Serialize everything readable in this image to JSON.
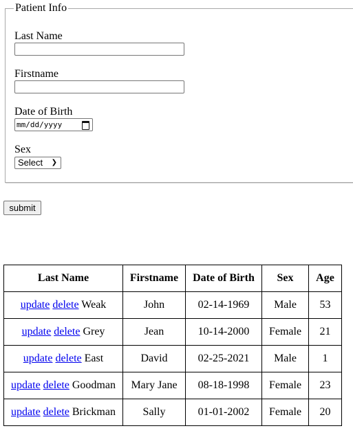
{
  "form": {
    "legend": "Patient Info",
    "last_name": {
      "label": "Last Name",
      "value": "",
      "placeholder": ""
    },
    "firstname": {
      "label": "Firstname",
      "value": "",
      "placeholder": ""
    },
    "dob": {
      "label": "Date of Birth",
      "placeholder": "mm/dd/yyyy",
      "icon": "calendar-icon"
    },
    "sex": {
      "label": "Sex",
      "selected": "Select",
      "icon": "chevron-down-icon"
    },
    "submit_label": "submit"
  },
  "table": {
    "headers": [
      "Last Name",
      "Firstname",
      "Date of Birth",
      "Sex",
      "Age"
    ],
    "update_label": "update",
    "delete_label": "delete",
    "rows": [
      {
        "last_name": "Weak",
        "firstname": "John",
        "dob": "02-14-1969",
        "sex": "Male",
        "age": "53"
      },
      {
        "last_name": "Grey",
        "firstname": "Jean",
        "dob": "10-14-2000",
        "sex": "Female",
        "age": "21"
      },
      {
        "last_name": "East",
        "firstname": "David",
        "dob": "02-25-2021",
        "sex": "Male",
        "age": "1"
      },
      {
        "last_name": "Goodman",
        "firstname": "Mary Jane",
        "dob": "08-18-1998",
        "sex": "Female",
        "age": "23"
      },
      {
        "last_name": "Brickman",
        "firstname": "Sally",
        "dob": "01-01-2002",
        "sex": "Female",
        "age": "20"
      }
    ]
  }
}
